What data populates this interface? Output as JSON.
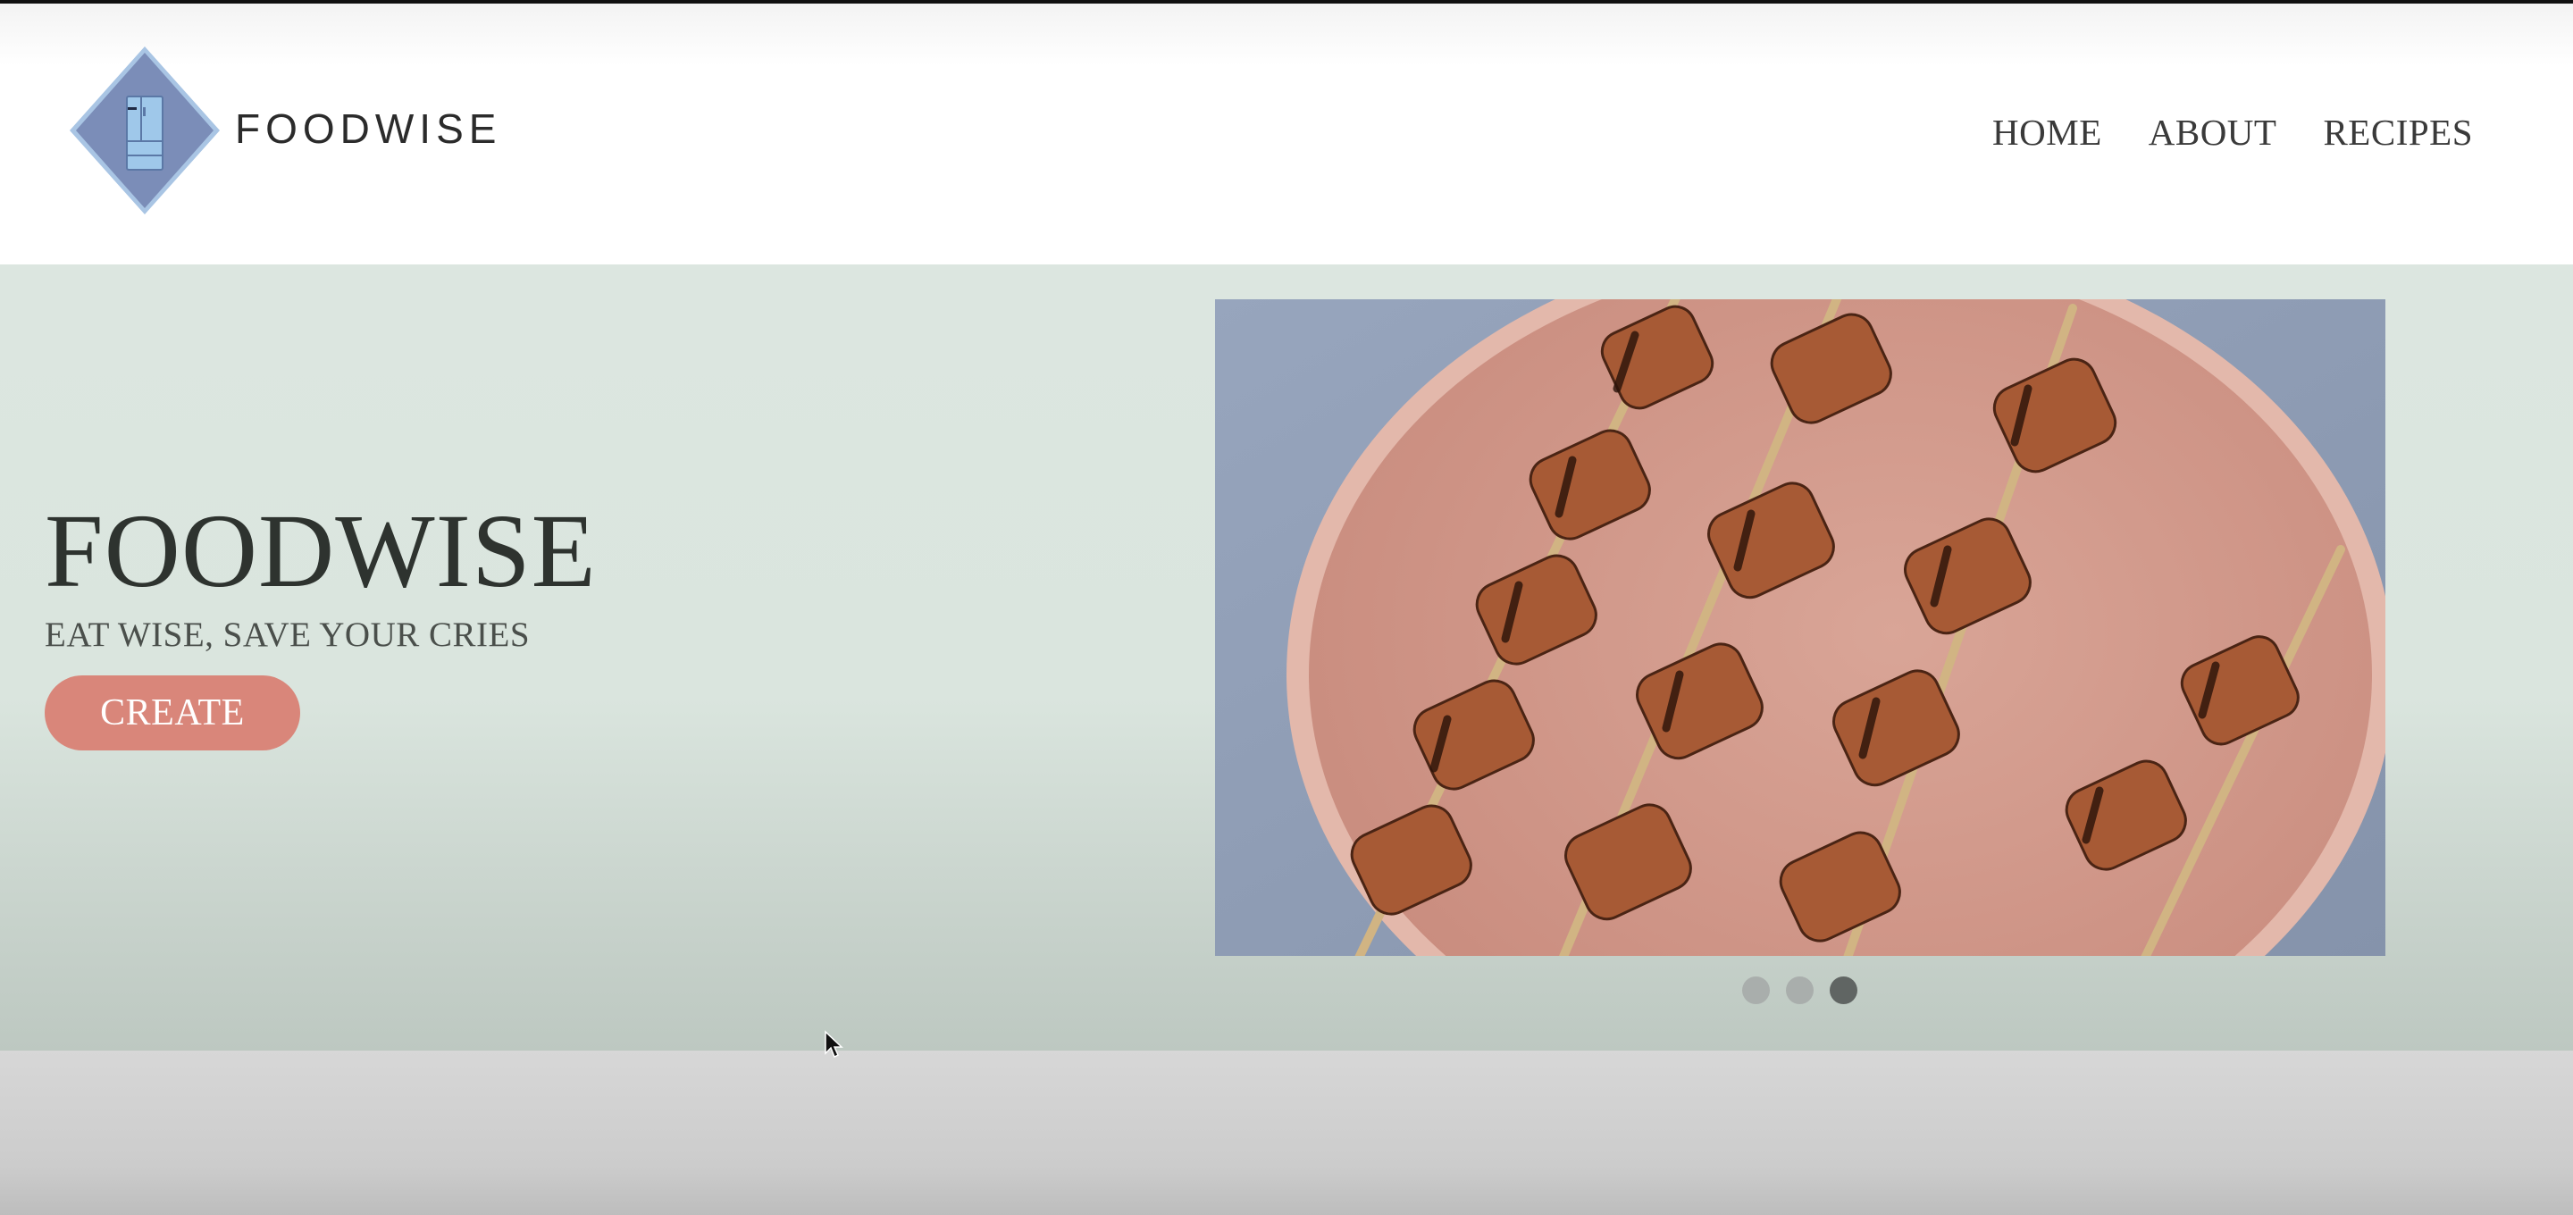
{
  "header": {
    "brand": "FOODWISE",
    "logo_icon": "fridge-icon",
    "nav": [
      {
        "label": "HOME"
      },
      {
        "label": "ABOUT"
      },
      {
        "label": "RECIPES"
      }
    ]
  },
  "hero": {
    "title": "FOODWISE",
    "subtitle": "EAT WISE, SAVE YOUR CRIES",
    "cta_label": "CREATE",
    "slide_image": "grilled-skewers-on-plate",
    "carousel": {
      "count": 3,
      "active": 3
    }
  },
  "colors": {
    "hero_bg": "#dce6e0",
    "cta": "#d9867a",
    "logo_diamond": "#7a8fb7",
    "dot_active": "#606563",
    "dot_inactive": "#a9aeac"
  }
}
